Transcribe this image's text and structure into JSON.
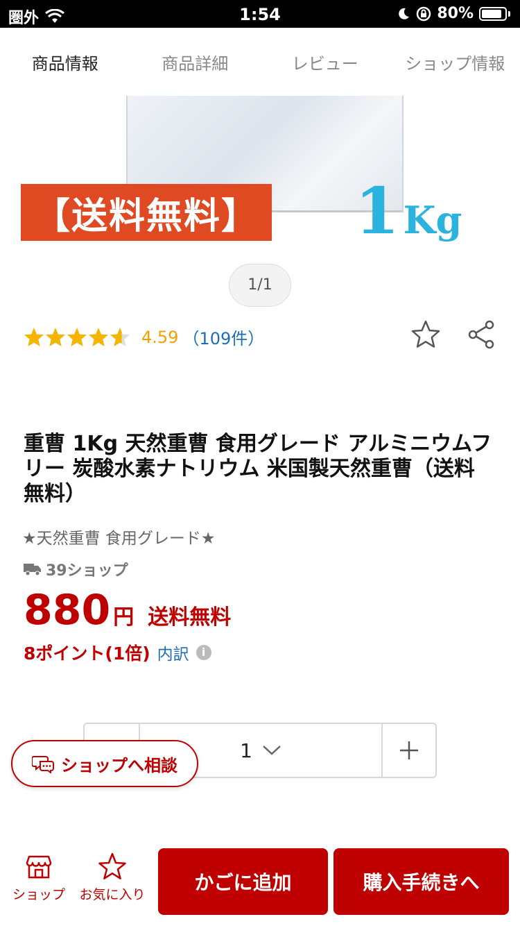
{
  "status_bar": {
    "carrier": "圏外",
    "time": "1:54",
    "battery": "80%"
  },
  "tabs": [
    {
      "label": "商品情報"
    },
    {
      "label": "商品詳細"
    },
    {
      "label": "レビュー"
    },
    {
      "label": "ショップ情報"
    }
  ],
  "image": {
    "banner_text": "【送料無料】",
    "weight_number": "1",
    "weight_unit": "Kg",
    "pager": "1/1"
  },
  "rating": {
    "stars": 4.59,
    "score": "4.59",
    "count": "（109件）"
  },
  "product": {
    "title": "重曹 1Kg 天然重曹 食用グレード アルミニウムフリー 炭酸水素ナトリウム 米国製天然重曹（送料無料）",
    "subtitle": "★天然重曹 食用グレード★",
    "shipping_badge": "39ショップ",
    "price": "880",
    "yen": "円",
    "free_shipping": "送料無料",
    "points": "8ポイント(1倍)",
    "breakdown": "内訳"
  },
  "quantity": {
    "value": "1"
  },
  "consult_button": "ショップへ相談",
  "bottom_bar": {
    "shop_label": "ショップ",
    "favorite_label": "お気に入り",
    "add_cart": "かごに追加",
    "checkout": "購入手続きへ"
  },
  "colors": {
    "accent_red": "#bf0000",
    "star_yellow": "#f5b400",
    "link_blue": "#1d6eb8",
    "banner_red": "#e04a23",
    "kg_blue": "#2bb3df"
  }
}
